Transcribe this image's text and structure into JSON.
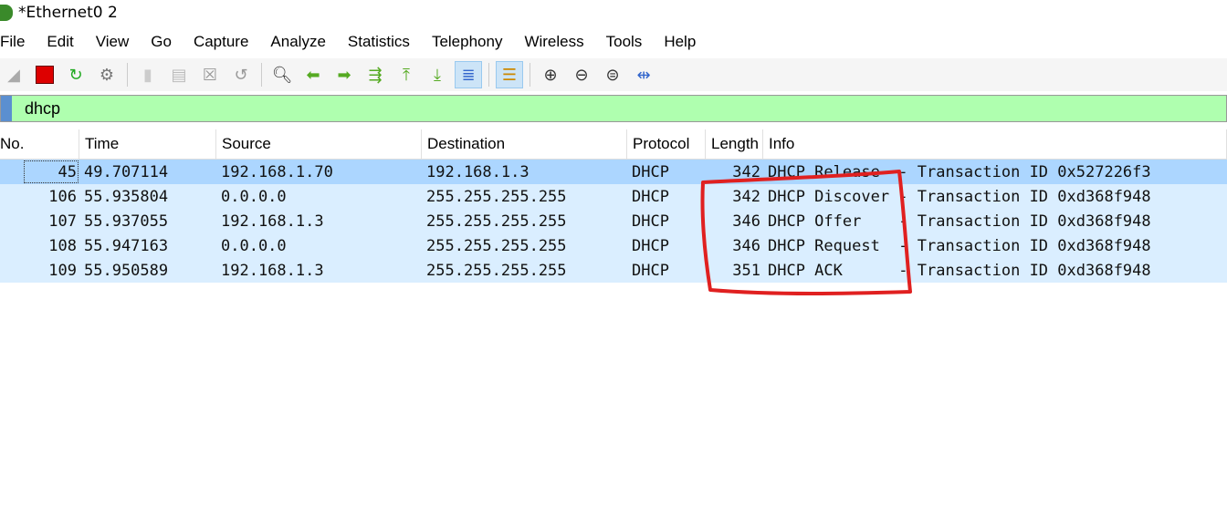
{
  "window": {
    "title": "*Ethernet0 2"
  },
  "menu": [
    "File",
    "Edit",
    "View",
    "Go",
    "Capture",
    "Analyze",
    "Statistics",
    "Telephony",
    "Wireless",
    "Tools",
    "Help"
  ],
  "filter": {
    "value": "dhcp"
  },
  "columns": [
    "No.",
    "Time",
    "Source",
    "Destination",
    "Protocol",
    "Length",
    "Info"
  ],
  "packets": [
    [
      "45",
      "49.707114",
      "192.168.1.70",
      "192.168.1.3",
      "DHCP",
      "342",
      "DHCP Release  - Transaction ID 0x527226f3"
    ],
    [
      "106",
      "55.935804",
      "0.0.0.0",
      "255.255.255.255",
      "DHCP",
      "342",
      "DHCP Discover - Transaction ID 0xd368f948"
    ],
    [
      "107",
      "55.937055",
      "192.168.1.3",
      "255.255.255.255",
      "DHCP",
      "346",
      "DHCP Offer    - Transaction ID 0xd368f948"
    ],
    [
      "108",
      "55.947163",
      "0.0.0.0",
      "255.255.255.255",
      "DHCP",
      "346",
      "DHCP Request  - Transaction ID 0xd368f948"
    ],
    [
      "109",
      "55.950589",
      "192.168.1.3",
      "255.255.255.255",
      "DHCP",
      "351",
      "DHCP ACK      - Transaction ID 0xd368f948"
    ]
  ],
  "selected_row": 0,
  "colors": {
    "filter_ok": "#afffaf",
    "row_selected": "#acd6ff",
    "row": "#daeeff",
    "annotation": "#e02020"
  }
}
